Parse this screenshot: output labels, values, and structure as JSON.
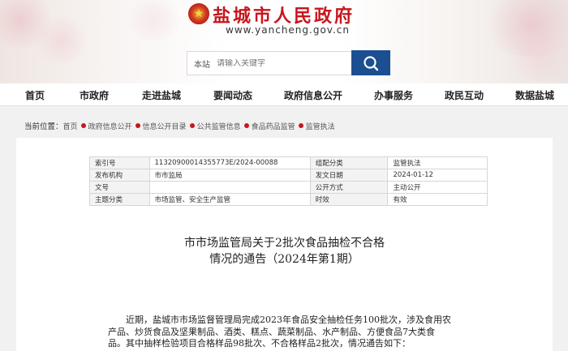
{
  "header": {
    "site_title": "盐城市人民政府",
    "site_url": "www.yancheng.gov.cn",
    "search": {
      "scope": "本站",
      "placeholder": "请输入关键字"
    }
  },
  "nav": {
    "items": [
      "首页",
      "市政府",
      "走进盐城",
      "要闻动态",
      "政府信息公开",
      "办事服务",
      "政民互动",
      "数据盐城"
    ]
  },
  "breadcrumb": {
    "lead": "当前位置：",
    "items": [
      "首页",
      "政府信息公开",
      "信息公开目录",
      "公共监管信息",
      "食品药品监管",
      "监管执法"
    ]
  },
  "meta": {
    "rows": [
      {
        "k1": "索引号",
        "v1": "11320900014355773E/2024-00088",
        "k2": "组配分类",
        "v2": "监管执法"
      },
      {
        "k1": "发布机构",
        "v1": "市市监局",
        "k2": "发文日期",
        "v2": "2024-01-12"
      },
      {
        "k1": "文号",
        "v1": "",
        "k2": "公开方式",
        "v2": "主动公开"
      },
      {
        "k1": "主题分类",
        "v1": "市场监管、安全生产监管",
        "k2": "时效",
        "v2": "有效"
      }
    ]
  },
  "article": {
    "title_line1": "市市场监管局关于2批次食品抽检不合格",
    "title_line2": "情况的通告（2024年第1期）",
    "body_lines": [
      "　　近期，盐城市市场监督管理局完成2023年食品安全抽检任务100批次，涉及食用农",
      "产品、炒货食品及坚果制品、酒类、糕点、蔬菜制品、水产制品、方便食品7大类食",
      "品。其中抽样检验项目合格样品98批次、不合格样品2批次，情况通告如下："
    ]
  },
  "colors": {
    "title_red": "#c8161d",
    "search_blue": "#1c4f91"
  }
}
